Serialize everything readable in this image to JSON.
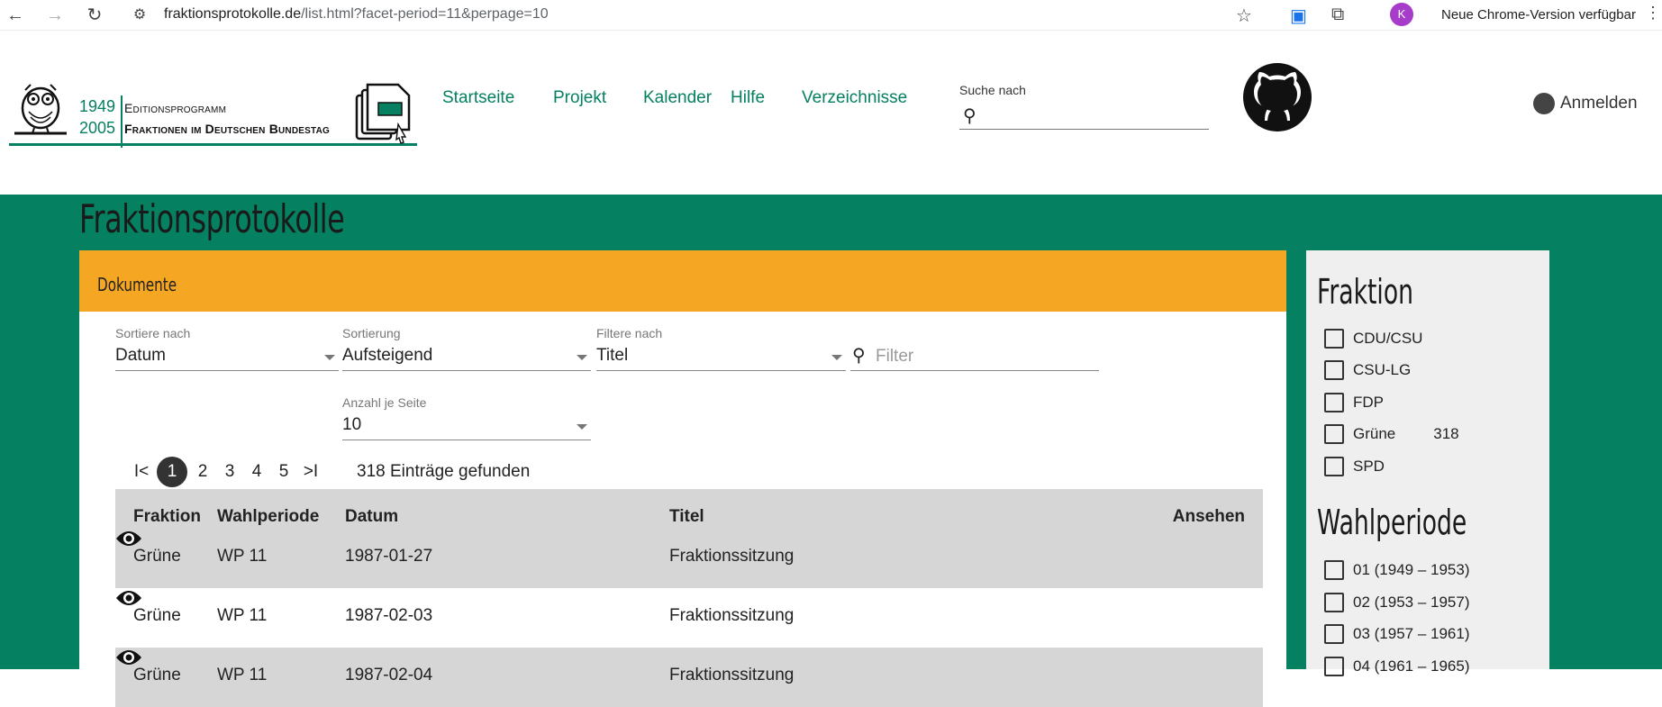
{
  "browser": {
    "url_host": "fraktionsprotokolle.de",
    "url_path": "/list.html?facet-period=11&perpage=10",
    "avatar_letter": "K",
    "update_notice": "Neue Chrome-Version verfügbar"
  },
  "logo": {
    "year_start": "1949",
    "year_end": "2005",
    "line1": "Editionsprogramm",
    "line2": "Fraktionen im Deutschen Bundestag"
  },
  "nav": {
    "items": [
      "Startseite",
      "Projekt",
      "Kalender",
      "Hilfe",
      "Verzeichnisse"
    ],
    "search_label": "Suche nach",
    "login": "Anmelden"
  },
  "page": {
    "title": "Fraktionsprotokolle",
    "panel_title": "Dokumente"
  },
  "controls": {
    "sort_by_label": "Sortiere nach",
    "sort_by_value": "Datum",
    "order_label": "Sortierung",
    "order_value": "Aufsteigend",
    "filter_by_label": "Filtere nach",
    "filter_by_value": "Titel",
    "filter_placeholder": "Filter",
    "per_page_label": "Anzahl je Seite",
    "per_page_value": "10"
  },
  "pager": {
    "first": "I<",
    "pages": [
      "1",
      "2",
      "3",
      "4",
      "5"
    ],
    "last": ">I",
    "count": "318 Einträge gefunden"
  },
  "table": {
    "headers": [
      "Fraktion",
      "Wahlperiode",
      "Datum",
      "Titel",
      "Ansehen"
    ],
    "rows": [
      [
        "Grüne",
        "WP 11",
        "1987-01-27",
        "Fraktionssitzung"
      ],
      [
        "Grüne",
        "WP 11",
        "1987-02-03",
        "Fraktionssitzung"
      ],
      [
        "Grüne",
        "WP 11",
        "1987-02-04",
        "Fraktionssitzung"
      ]
    ]
  },
  "facets": {
    "fraktion_title": "Fraktion",
    "fraktion": [
      {
        "label": "CDU/CSU",
        "count": ""
      },
      {
        "label": "CSU-LG",
        "count": ""
      },
      {
        "label": "FDP",
        "count": ""
      },
      {
        "label": "Grüne",
        "count": "318"
      },
      {
        "label": "SPD",
        "count": ""
      }
    ],
    "wp_title": "Wahlperiode",
    "wahlperiode": [
      {
        "label": "01 (1949 – 1953)"
      },
      {
        "label": "02 (1953 – 1957)"
      },
      {
        "label": "03 (1957 – 1961)"
      },
      {
        "label": "04 (1961 – 1965)"
      }
    ]
  },
  "colors": {
    "brand_green": "#058060",
    "panel_orange": "#f5a623"
  }
}
